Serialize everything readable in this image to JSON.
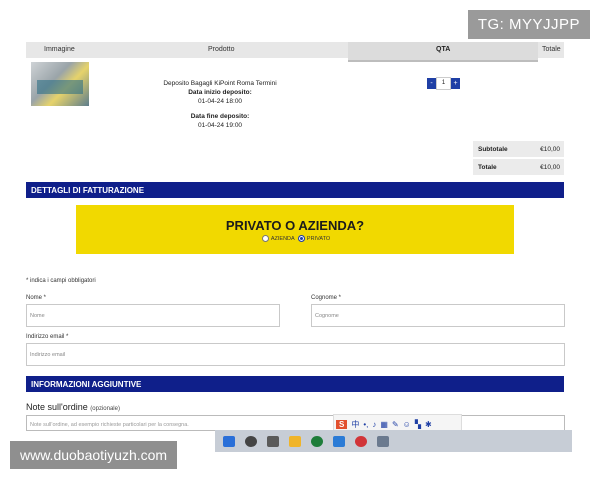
{
  "watermark_top": "TG: MYYJJPP",
  "watermark_bottom": "www.duobaotiyuzh.com",
  "cart": {
    "headers": {
      "image": "Immagine",
      "product": "Prodotto",
      "qty": "QTA",
      "total": "Totale"
    },
    "item": {
      "name": "Deposito Bagagli KiPoint Roma Termini",
      "start_label": "Data inizio deposito:",
      "start_value": "01-04-24 18:00",
      "end_label": "Data fine deposito:",
      "end_value": "01-04-24 19:00",
      "qty": "1",
      "minus": "-",
      "plus": "+"
    },
    "subtotal_label": "Subtotale",
    "subtotal_value": "€10,00",
    "total_label": "Totale",
    "total_value": "€10,00"
  },
  "billing": {
    "title": "DETTAGLI DI FATTURAZIONE",
    "question": "PRIVATO O AZIENDA?",
    "option_company": "AZIENDA",
    "option_private": "PRIVATO",
    "required_note": "* indica i campi obbligatori",
    "first_name_label": "Nome *",
    "first_name_placeholder": "Nome",
    "last_name_label": "Cognome *",
    "last_name_placeholder": "Cognome",
    "email_label": "Indirizzo email *",
    "email_placeholder": "Indirizzo email"
  },
  "additional": {
    "title": "INFORMAZIONI AGGIUNTIVE",
    "notes_label": "Note sull'ordine",
    "notes_optional": "(opzionale)",
    "notes_placeholder": "Note sull'ordine, ad esempio richieste particolari per la consegna."
  },
  "ime": {
    "logo": "S",
    "mode": "中"
  },
  "colors": {
    "accent": "#0f1f8a",
    "yellow": "#f1d900",
    "button": "#1f3fa5"
  }
}
